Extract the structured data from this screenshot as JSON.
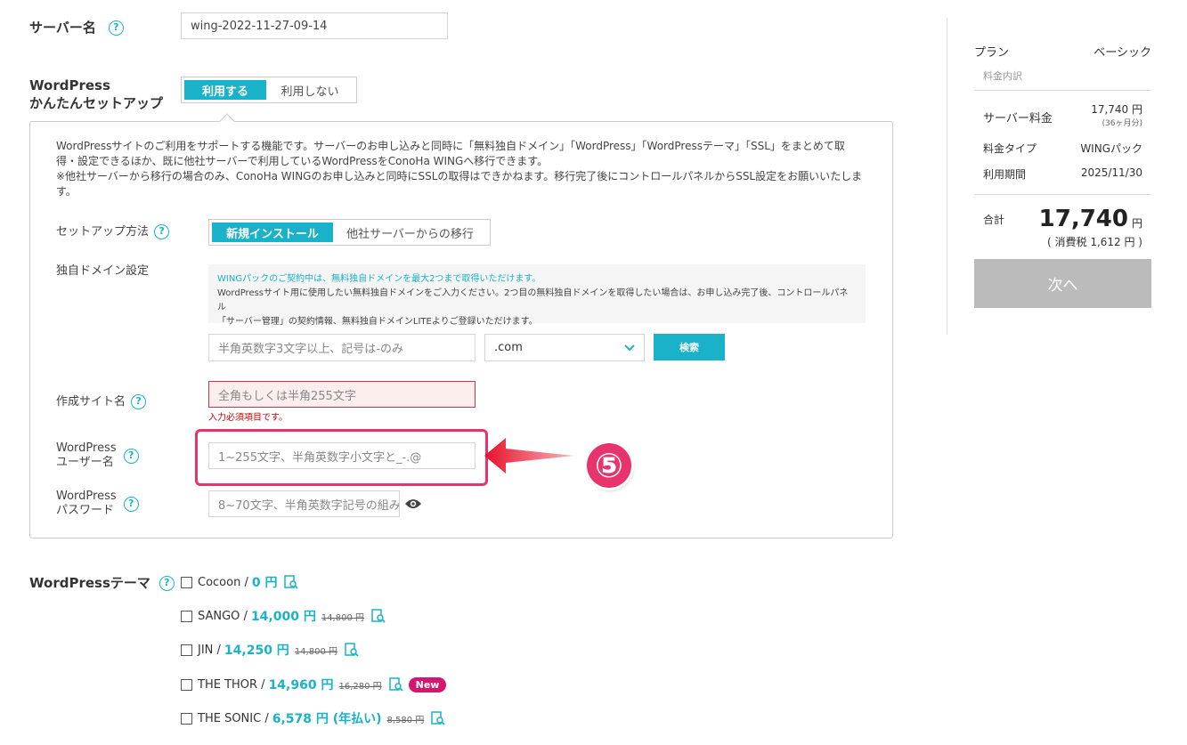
{
  "server_name": {
    "label": "サーバー名",
    "value": "wing-2022-11-27-09-14"
  },
  "wp_setup": {
    "label_line1": "WordPress",
    "label_line2": "かんたんセットアップ",
    "use_label": "利用する",
    "nouse_label": "利用しない"
  },
  "description": {
    "line1": "WordPressサイトのご利用をサポートする機能です。サーバーのお申し込みと同時に「無料独自ドメイン」「WordPress」「WordPressテーマ」「SSL」をまとめて取",
    "line2": "得・設定できるほか、既に他社サーバーで利用しているWordPressをConoHa WINGへ移行できます。",
    "line3": "※他社サーバーから移行の場合のみ、ConoHa WINGのお申し込みと同時にSSLの取得はできかねます。移行完了後にコントロールパネルからSSL設定をお願いいたしま",
    "line4": "す。"
  },
  "setup_method": {
    "label": "セットアップ方法",
    "new_install": "新規インストール",
    "migrate": "他社サーバーからの移行"
  },
  "domain": {
    "label": "独自ドメイン設定",
    "note1": "WINGパックのご契約中は、無料独自ドメインを最大2つまで取得いただけます。",
    "note2": "WordPressサイト用に使用したい無料独自ドメインをご入力ください。2つ目の無料独自ドメインを取得したい場合は、お申し込み完了後、コントロールパネル",
    "note3": "「サーバー管理」の契約情報、無料独自ドメインLITEよりご登録いただけます。",
    "placeholder": "半角英数字3文字以上、記号は-のみ",
    "tld": ".com",
    "search_label": "検索"
  },
  "site_name": {
    "label": "作成サイト名",
    "placeholder": "全角もしくは半角255文字",
    "error": "入力必須項目です。"
  },
  "wp_user": {
    "label_line1": "WordPress",
    "label_line2": "ユーザー名",
    "placeholder": "1~255文字、半角英数字小文字と_-.@"
  },
  "wp_pass": {
    "label_line1": "WordPress",
    "label_line2": "パスワード",
    "placeholder": "8~70文字、半角英数字記号の組み合わせ"
  },
  "annotation": {
    "number": "⑤"
  },
  "themes": {
    "label": "WordPressテーマ",
    "items": [
      {
        "name": "Cocoon /",
        "price": "0 円",
        "old": ""
      },
      {
        "name": "SANGO /",
        "price": "14,000 円",
        "old": "14,800 円"
      },
      {
        "name": "JIN /",
        "price": "14,250 円",
        "old": "14,800 円"
      },
      {
        "name": "THE THOR /",
        "price": "14,960 円",
        "old": "16,280 円",
        "badge": "New"
      },
      {
        "name": "THE SONIC /",
        "price": "6,578 円 (年払い)",
        "old": "8,580 円"
      }
    ]
  },
  "sidebar": {
    "plan_label": "プラン",
    "plan_value": "ベーシック",
    "breakdown_label": "料金内訳",
    "server_fee_label": "サーバー料金",
    "server_fee_value": "17,740 円",
    "server_fee_sub": "(36ヶ月分)",
    "fee_type_label": "料金タイプ",
    "fee_type_value": "WINGパック",
    "period_label": "利用期間",
    "period_value": "2025/11/30",
    "total_label": "合計",
    "total_value": "17,740",
    "total_unit": "円",
    "tax": "( 消費税 1,612 円 )",
    "next_label": "次へ"
  },
  "colors": {
    "accent": "#19b2c9",
    "error": "#cc0000",
    "highlight": "#e8336d",
    "disabled": "#bbbbbb"
  }
}
